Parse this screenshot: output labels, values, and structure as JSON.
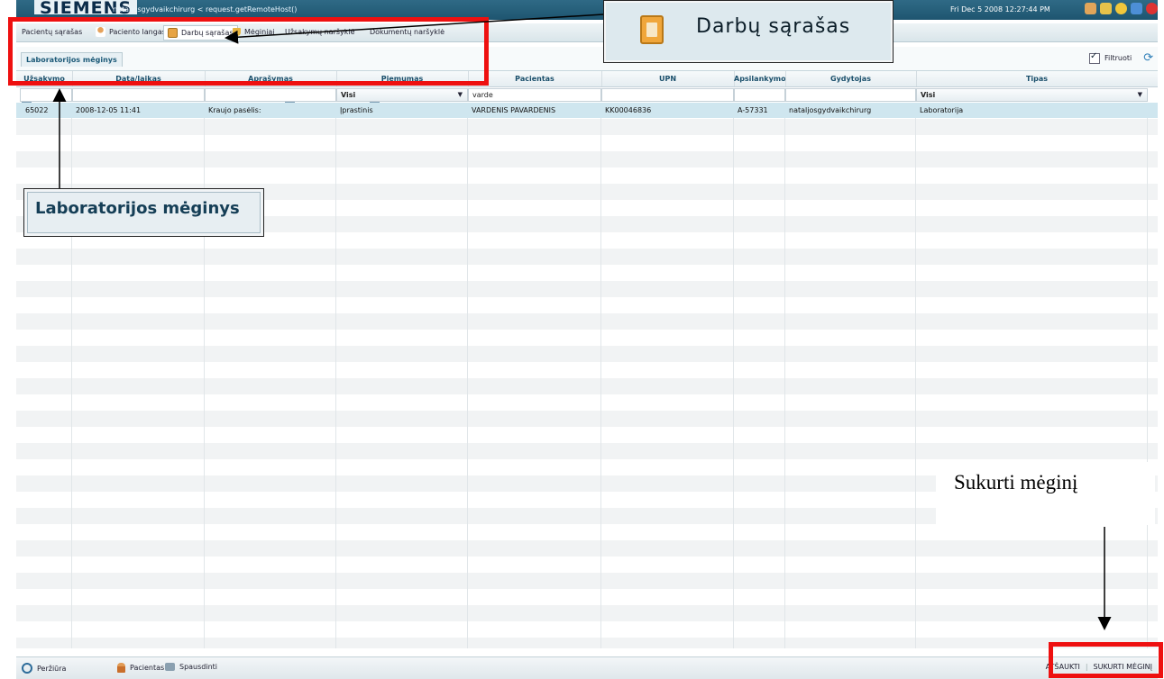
{
  "header": {
    "logo": "SIEMENS",
    "user": "nataljosgydvaikchirurg   < request.getRemoteHost()",
    "datetime": "Fri Dec 5 2008 12:27:44 PM",
    "icons": [
      "user-icon",
      "key-icon",
      "help-icon",
      "window-icon",
      "close-icon"
    ]
  },
  "nav": {
    "tabs": [
      {
        "label": "Pacientų sąrašas",
        "icon": "grid-icon"
      },
      {
        "label": "Paciento langas",
        "icon": "person-icon"
      },
      {
        "label": "Darbų sąrašas",
        "icon": "clipboard-icon"
      },
      {
        "label": "Mėginiai",
        "icon": "flask-icon"
      },
      {
        "label": "Užsakymų naršyklė",
        "icon": "grid-icon"
      },
      {
        "label": "Dokumentų naršyklė",
        "icon": "grid-icon"
      }
    ]
  },
  "subbar": {
    "tab": "Laboratorijos mėginys",
    "filter_label": "Filtruoti",
    "filter_checked": true
  },
  "table": {
    "headers": [
      "Užsakymo",
      "Data/laikas",
      "Aprašymas",
      "Piemumas",
      "Pacientas",
      "UPN",
      "Apsilankymo",
      "Gydytojas",
      "Tipas"
    ],
    "filters": {
      "piemumas": "Visi",
      "pacientas": "varde",
      "tipas": "Visi"
    },
    "rows": [
      [
        "65022",
        "2008-12-05 11:41",
        "Kraujo pasėlis:",
        "Įprastinis",
        "VARDENIS PAVARDENIS",
        "KK00046836",
        "A-57331",
        "nataljosgydvaikchirurg",
        "Laboratorija"
      ]
    ]
  },
  "footer": {
    "left": [
      "Peržiūra",
      "Pacientas",
      "Spausdinti"
    ],
    "right": [
      "ATŠAUKTI",
      "SUKURTI MĖGINĮ"
    ]
  },
  "annotations": {
    "worklist_callout": "Darbų sąrašas",
    "lab_callout": "Laboratorijos mėginys",
    "create_note": "Sukurti mėginį"
  },
  "colors": {
    "highlight": "#ee1010",
    "header": "#1e5570",
    "selected_row": "#cfe6ef"
  }
}
